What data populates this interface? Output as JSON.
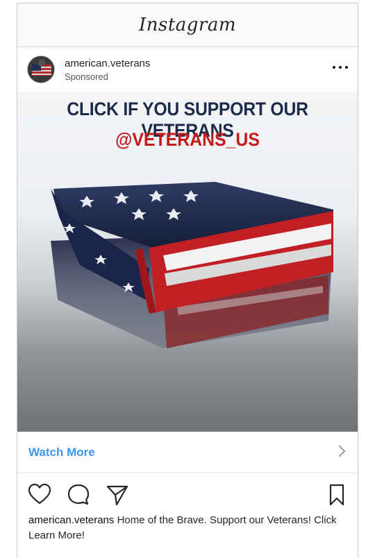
{
  "app": {
    "title": "Instagram"
  },
  "post": {
    "username": "american.veterans",
    "label": "Sponsored",
    "media": {
      "headline": "CLICK IF YOU SUPPORT OUR VETERANS",
      "handle": "@VETERANS_US",
      "headline_color": "#1e2a4a",
      "handle_color": "#c81a1a"
    },
    "cta": {
      "label": "Watch More",
      "color": "#3897f0"
    },
    "caption": {
      "username": "american.veterans",
      "text": "Home of the Brave. Support our Veterans! Click Learn More!"
    }
  },
  "icons": {
    "more": "more-options-icon",
    "like": "heart-icon",
    "comment": "comment-icon",
    "share": "share-icon",
    "save": "bookmark-icon",
    "chevron": "chevron-right-icon"
  }
}
